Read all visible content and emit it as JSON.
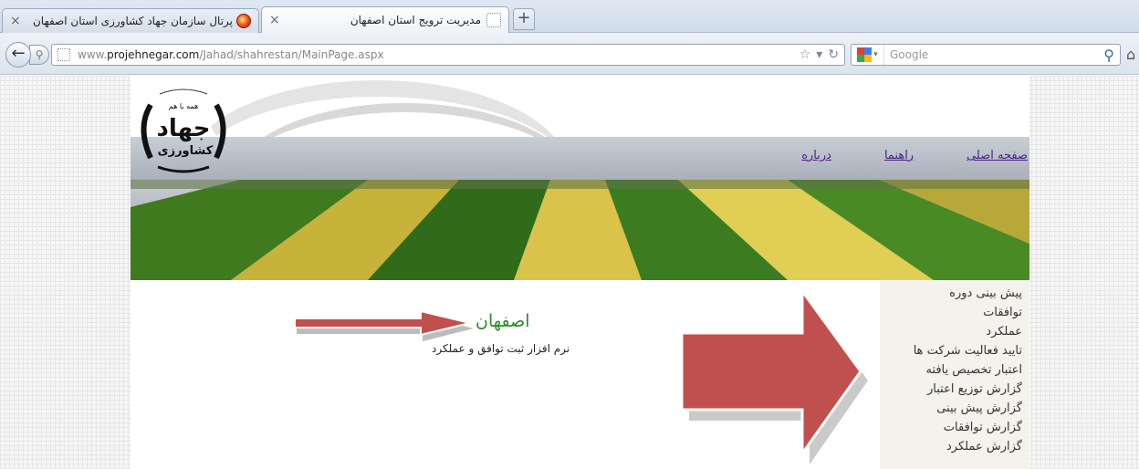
{
  "browser": {
    "tabs": [
      {
        "title": "پرتال سازمان جهاد کشاورزی استان اصفهان",
        "active": false
      },
      {
        "title": "مدیریت ترویج استان اصفهان",
        "active": true
      }
    ],
    "new_tab_label": "+",
    "url_prefix": "www.",
    "url_domain": "projehnegar.com",
    "url_path": "/Jahad/shahrestan/MainPage.aspx",
    "search_placeholder": "Google",
    "search_engine_colors": [
      "#e53f2f",
      "#3a7ff1",
      "#36a852",
      "#fbbc05"
    ]
  },
  "site": {
    "logo": {
      "top_text": "همه با هم",
      "main_text": "جهاد",
      "sub_text": "کشاورزی"
    },
    "menu": [
      "صفحه اصلی",
      "راهنما",
      "درباره"
    ],
    "sidebar": [
      "پیش بینی دوره",
      "توافقات",
      "عملکرد",
      "تایید فعالیت شرکت ها",
      "اعتبار تخصیص یافته",
      "گزارش توزیع اعتبار",
      "گزارش پیش بینی",
      "گزارش توافقات",
      "گزارش عملکرد"
    ],
    "org_title": "اصفهان",
    "org_subtitle": "نرم افزار ثبت توافق و عملکرد",
    "colors": {
      "arrow_red": "#c0504d",
      "title_green": "#2e8b2e",
      "link_purple": "#4a1f8a"
    }
  }
}
